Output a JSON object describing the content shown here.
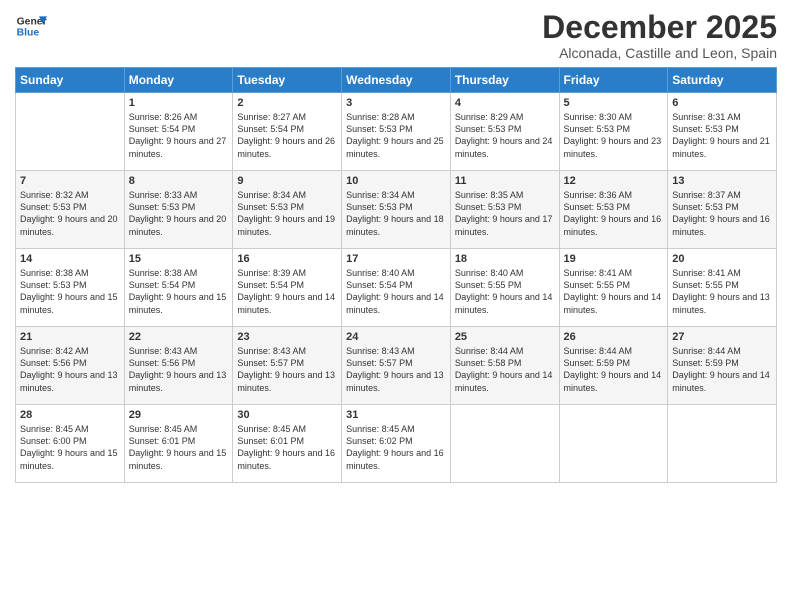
{
  "logo": {
    "line1": "General",
    "line2": "Blue"
  },
  "title": "December 2025",
  "subtitle": "Alconada, Castille and Leon, Spain",
  "days_of_week": [
    "Sunday",
    "Monday",
    "Tuesday",
    "Wednesday",
    "Thursday",
    "Friday",
    "Saturday"
  ],
  "weeks": [
    [
      {
        "day": "",
        "info": ""
      },
      {
        "day": "1",
        "sunrise": "8:26 AM",
        "sunset": "5:54 PM",
        "daylight": "9 hours and 27 minutes."
      },
      {
        "day": "2",
        "sunrise": "8:27 AM",
        "sunset": "5:54 PM",
        "daylight": "9 hours and 26 minutes."
      },
      {
        "day": "3",
        "sunrise": "8:28 AM",
        "sunset": "5:53 PM",
        "daylight": "9 hours and 25 minutes."
      },
      {
        "day": "4",
        "sunrise": "8:29 AM",
        "sunset": "5:53 PM",
        "daylight": "9 hours and 24 minutes."
      },
      {
        "day": "5",
        "sunrise": "8:30 AM",
        "sunset": "5:53 PM",
        "daylight": "9 hours and 23 minutes."
      },
      {
        "day": "6",
        "sunrise": "8:31 AM",
        "sunset": "5:53 PM",
        "daylight": "9 hours and 21 minutes."
      }
    ],
    [
      {
        "day": "7",
        "sunrise": "8:32 AM",
        "sunset": "5:53 PM",
        "daylight": "9 hours and 20 minutes."
      },
      {
        "day": "8",
        "sunrise": "8:33 AM",
        "sunset": "5:53 PM",
        "daylight": "9 hours and 20 minutes."
      },
      {
        "day": "9",
        "sunrise": "8:34 AM",
        "sunset": "5:53 PM",
        "daylight": "9 hours and 19 minutes."
      },
      {
        "day": "10",
        "sunrise": "8:34 AM",
        "sunset": "5:53 PM",
        "daylight": "9 hours and 18 minutes."
      },
      {
        "day": "11",
        "sunrise": "8:35 AM",
        "sunset": "5:53 PM",
        "daylight": "9 hours and 17 minutes."
      },
      {
        "day": "12",
        "sunrise": "8:36 AM",
        "sunset": "5:53 PM",
        "daylight": "9 hours and 16 minutes."
      },
      {
        "day": "13",
        "sunrise": "8:37 AM",
        "sunset": "5:53 PM",
        "daylight": "9 hours and 16 minutes."
      }
    ],
    [
      {
        "day": "14",
        "sunrise": "8:38 AM",
        "sunset": "5:53 PM",
        "daylight": "9 hours and 15 minutes."
      },
      {
        "day": "15",
        "sunrise": "8:38 AM",
        "sunset": "5:54 PM",
        "daylight": "9 hours and 15 minutes."
      },
      {
        "day": "16",
        "sunrise": "8:39 AM",
        "sunset": "5:54 PM",
        "daylight": "9 hours and 14 minutes."
      },
      {
        "day": "17",
        "sunrise": "8:40 AM",
        "sunset": "5:54 PM",
        "daylight": "9 hours and 14 minutes."
      },
      {
        "day": "18",
        "sunrise": "8:40 AM",
        "sunset": "5:55 PM",
        "daylight": "9 hours and 14 minutes."
      },
      {
        "day": "19",
        "sunrise": "8:41 AM",
        "sunset": "5:55 PM",
        "daylight": "9 hours and 14 minutes."
      },
      {
        "day": "20",
        "sunrise": "8:41 AM",
        "sunset": "5:55 PM",
        "daylight": "9 hours and 13 minutes."
      }
    ],
    [
      {
        "day": "21",
        "sunrise": "8:42 AM",
        "sunset": "5:56 PM",
        "daylight": "9 hours and 13 minutes."
      },
      {
        "day": "22",
        "sunrise": "8:43 AM",
        "sunset": "5:56 PM",
        "daylight": "9 hours and 13 minutes."
      },
      {
        "day": "23",
        "sunrise": "8:43 AM",
        "sunset": "5:57 PM",
        "daylight": "9 hours and 13 minutes."
      },
      {
        "day": "24",
        "sunrise": "8:43 AM",
        "sunset": "5:57 PM",
        "daylight": "9 hours and 13 minutes."
      },
      {
        "day": "25",
        "sunrise": "8:44 AM",
        "sunset": "5:58 PM",
        "daylight": "9 hours and 14 minutes."
      },
      {
        "day": "26",
        "sunrise": "8:44 AM",
        "sunset": "5:59 PM",
        "daylight": "9 hours and 14 minutes."
      },
      {
        "day": "27",
        "sunrise": "8:44 AM",
        "sunset": "5:59 PM",
        "daylight": "9 hours and 14 minutes."
      }
    ],
    [
      {
        "day": "28",
        "sunrise": "8:45 AM",
        "sunset": "6:00 PM",
        "daylight": "9 hours and 15 minutes."
      },
      {
        "day": "29",
        "sunrise": "8:45 AM",
        "sunset": "6:01 PM",
        "daylight": "9 hours and 15 minutes."
      },
      {
        "day": "30",
        "sunrise": "8:45 AM",
        "sunset": "6:01 PM",
        "daylight": "9 hours and 16 minutes."
      },
      {
        "day": "31",
        "sunrise": "8:45 AM",
        "sunset": "6:02 PM",
        "daylight": "9 hours and 16 minutes."
      },
      {
        "day": "",
        "info": ""
      },
      {
        "day": "",
        "info": ""
      },
      {
        "day": "",
        "info": ""
      }
    ]
  ]
}
